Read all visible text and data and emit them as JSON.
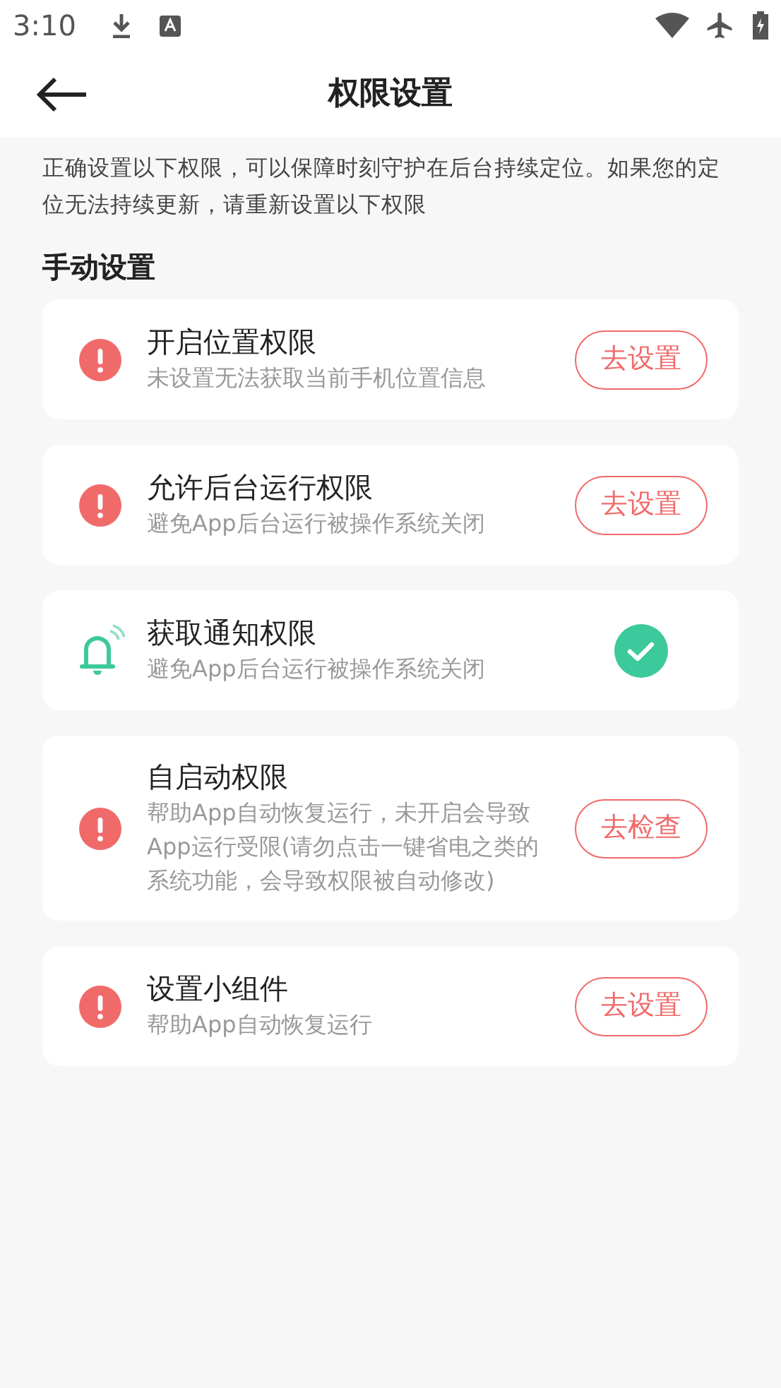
{
  "status_bar": {
    "time": "3:10"
  },
  "header": {
    "title": "权限设置"
  },
  "intro": "正确设置以下权限，可以保障时刻守护在后台持续定位。如果您的定位无法持续更新，请重新设置以下权限",
  "section": {
    "title": "手动设置"
  },
  "items": [
    {
      "title": "开启位置权限",
      "subtitle": "未设置无法获取当前手机位置信息",
      "done": false,
      "action": "去设置"
    },
    {
      "title": "允许后台运行权限",
      "subtitle": "避免App后台运行被操作系统关闭",
      "done": false,
      "action": "去设置"
    },
    {
      "title": "获取通知权限",
      "subtitle": "避免App后台运行被操作系统关闭",
      "done": true
    },
    {
      "title": "自启动权限",
      "subtitle": "帮助App自动恢复运行，未开启会导致App运行受限(请勿点击一键省电之类的系统功能，会导致权限被自动修改)",
      "done": false,
      "action": "去检查"
    },
    {
      "title": "设置小组件",
      "subtitle": "帮助App自动恢复运行",
      "done": false,
      "action": "去设置"
    }
  ]
}
